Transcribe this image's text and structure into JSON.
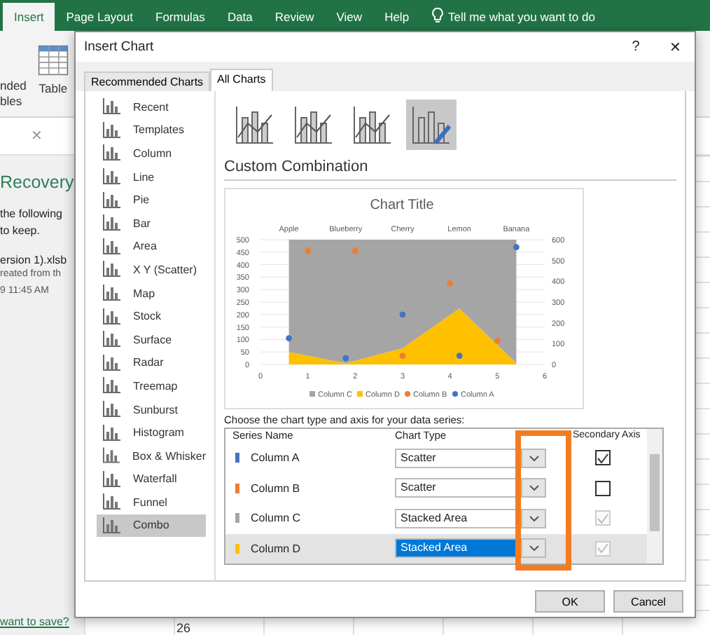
{
  "ribbon": {
    "tabs": [
      {
        "label": "Insert",
        "selected": true
      },
      {
        "label": "Page Layout",
        "selected": false
      },
      {
        "label": "Formulas",
        "selected": false
      },
      {
        "label": "Data",
        "selected": false
      },
      {
        "label": "Review",
        "selected": false
      },
      {
        "label": "View",
        "selected": false
      },
      {
        "label": "Help",
        "selected": false
      }
    ],
    "tell_me": "Tell me what you want to do",
    "buttons": [
      {
        "lines": [
          "nded",
          "bles"
        ]
      },
      {
        "lines": [
          "Table"
        ]
      }
    ]
  },
  "formula_bar": {
    "cancel": "✕"
  },
  "recovery_pane": {
    "title": "Recovery",
    "text_lines": [
      "the following",
      "to keep."
    ],
    "file_name": "ersion 1).xlsb",
    "file_note": "reated from th",
    "file_time": "9 11:45 AM",
    "link": "want to save?"
  },
  "grid": {
    "row_number": "26"
  },
  "dialog": {
    "title": "Insert Chart",
    "help": "?",
    "close": "✕",
    "tabs": [
      {
        "label": "Recommended Charts",
        "selected": false
      },
      {
        "label": "All Charts",
        "selected": true
      }
    ],
    "chart_types": [
      {
        "label": "Recent",
        "selected": false
      },
      {
        "label": "Templates",
        "selected": false
      },
      {
        "label": "Column",
        "selected": false
      },
      {
        "label": "Line",
        "selected": false
      },
      {
        "label": "Pie",
        "selected": false
      },
      {
        "label": "Bar",
        "selected": false
      },
      {
        "label": "Area",
        "selected": false
      },
      {
        "label": "X Y (Scatter)",
        "selected": false
      },
      {
        "label": "Map",
        "selected": false
      },
      {
        "label": "Stock",
        "selected": false
      },
      {
        "label": "Surface",
        "selected": false
      },
      {
        "label": "Radar",
        "selected": false
      },
      {
        "label": "Treemap",
        "selected": false
      },
      {
        "label": "Sunburst",
        "selected": false
      },
      {
        "label": "Histogram",
        "selected": false
      },
      {
        "label": "Box & Whisker",
        "selected": false
      },
      {
        "label": "Waterfall",
        "selected": false
      },
      {
        "label": "Funnel",
        "selected": false
      },
      {
        "label": "Combo",
        "selected": true
      }
    ],
    "subtypes": [
      {
        "selected": false
      },
      {
        "selected": false
      },
      {
        "selected": false
      },
      {
        "selected": true
      }
    ],
    "heading": "Custom Combination",
    "preview": {
      "chart_data": {
        "type": "scatter",
        "title": "Chart Title",
        "xlim": [
          0,
          6
        ],
        "ylim": [
          0,
          500
        ],
        "y2lim": [
          0,
          600
        ],
        "xticks": [
          0,
          1,
          2,
          3,
          4,
          5,
          6
        ],
        "yticks": [
          0,
          50,
          100,
          150,
          200,
          250,
          300,
          350,
          400,
          450,
          500
        ],
        "y2ticks": [
          0,
          100,
          200,
          300,
          400,
          500,
          600
        ],
        "annotations": [
          "Apple",
          "Blueberry",
          "Cherry",
          "Lemon",
          "Banana"
        ],
        "stacked": true,
        "grid": true,
        "legend": "bottom",
        "series": [
          {
            "name": "Column C",
            "color": "#a5a5a5",
            "type": "area",
            "x": [
              0.6,
              1.8,
              3,
              4.2,
              5.4
            ],
            "values": [
              450,
              495,
              435,
              275,
              495
            ]
          },
          {
            "name": "Column D",
            "color": "#ffc000",
            "type": "area",
            "x": [
              0.6,
              1.8,
              3,
              4.2,
              5.4
            ],
            "values": [
              50,
              5,
              65,
              225,
              5
            ]
          },
          {
            "name": "Column B",
            "color": "#ed7d31",
            "type": "scatter",
            "x": [
              1,
              2,
              3,
              4,
              5
            ],
            "values": [
              455,
              455,
              35,
              325,
              95
            ]
          },
          {
            "name": "Column A",
            "color": "#4472c4",
            "type": "scatter",
            "x": [
              0.6,
              1.8,
              3,
              4.2,
              5.4
            ],
            "values": [
              105,
              25,
              200,
              35,
              470
            ]
          }
        ]
      }
    },
    "series_prompt": "Choose the chart type and axis for your data series:",
    "columns": [
      "Series Name",
      "Chart Type",
      "Secondary Axis"
    ],
    "series_rows": [
      {
        "name": "Column A",
        "color": "#4472c4",
        "chart_type": "Scatter",
        "secondary": true,
        "disabled": false,
        "selected": false
      },
      {
        "name": "Column B",
        "color": "#ed7d31",
        "chart_type": "Scatter",
        "secondary": false,
        "disabled": false,
        "selected": false
      },
      {
        "name": "Column C",
        "color": "#a5a5a5",
        "chart_type": "Stacked Area",
        "secondary": true,
        "disabled": true,
        "selected": false
      },
      {
        "name": "Column D",
        "color": "#ffc000",
        "chart_type": "Stacked Area",
        "secondary": true,
        "disabled": true,
        "selected": true
      }
    ],
    "buttons": [
      "OK",
      "Cancel"
    ]
  }
}
